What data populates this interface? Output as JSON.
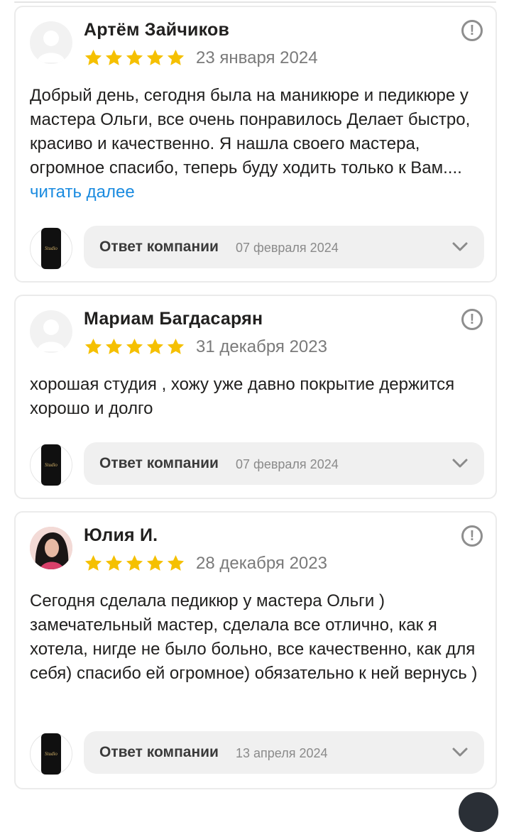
{
  "reviews": [
    {
      "author": "Артём Зайчиков",
      "date": "23 января 2024",
      "rating": 5,
      "avatar": "placeholder-avatar",
      "text": "Добрый день, сегодня была на маникюре и педикюре у мастера Ольги, все очень понравилось Делает быстро, красиво и качественно. Я нашла своего мастера, огромное спасибо, теперь буду ходить только к Вам....",
      "more_label": "читать далее",
      "reply_label": "Ответ компании",
      "reply_date": "07 февраля 2024"
    },
    {
      "author": "Мариам Багдасарян",
      "date": "31 декабря 2023",
      "rating": 5,
      "avatar": "placeholder-avatar",
      "text": "хорошая студия , хожу уже давно покрытие держится хорошо и долго",
      "more_label": "",
      "reply_label": "Ответ компании",
      "reply_date": "07 февраля 2024"
    },
    {
      "author": "Юлия И.",
      "date": "28 декабря 2023",
      "rating": 5,
      "avatar": "photo-avatar",
      "text": "Сегодня сделала педикюр у мастера Ольги ) замечательный мастер, сделала все отлично, как я хотела, нигде не было больно, все качественно, как для себя) спасибо ей огромное) обязательно к ней вернусь )",
      "more_label": "",
      "reply_label": "Ответ компании",
      "reply_date": "13 апреля 2024"
    }
  ],
  "company_logo_text": "Studio",
  "colors": {
    "star": "#f5c000",
    "link": "#1a8be0",
    "reply_bg": "#f0f0f0"
  }
}
